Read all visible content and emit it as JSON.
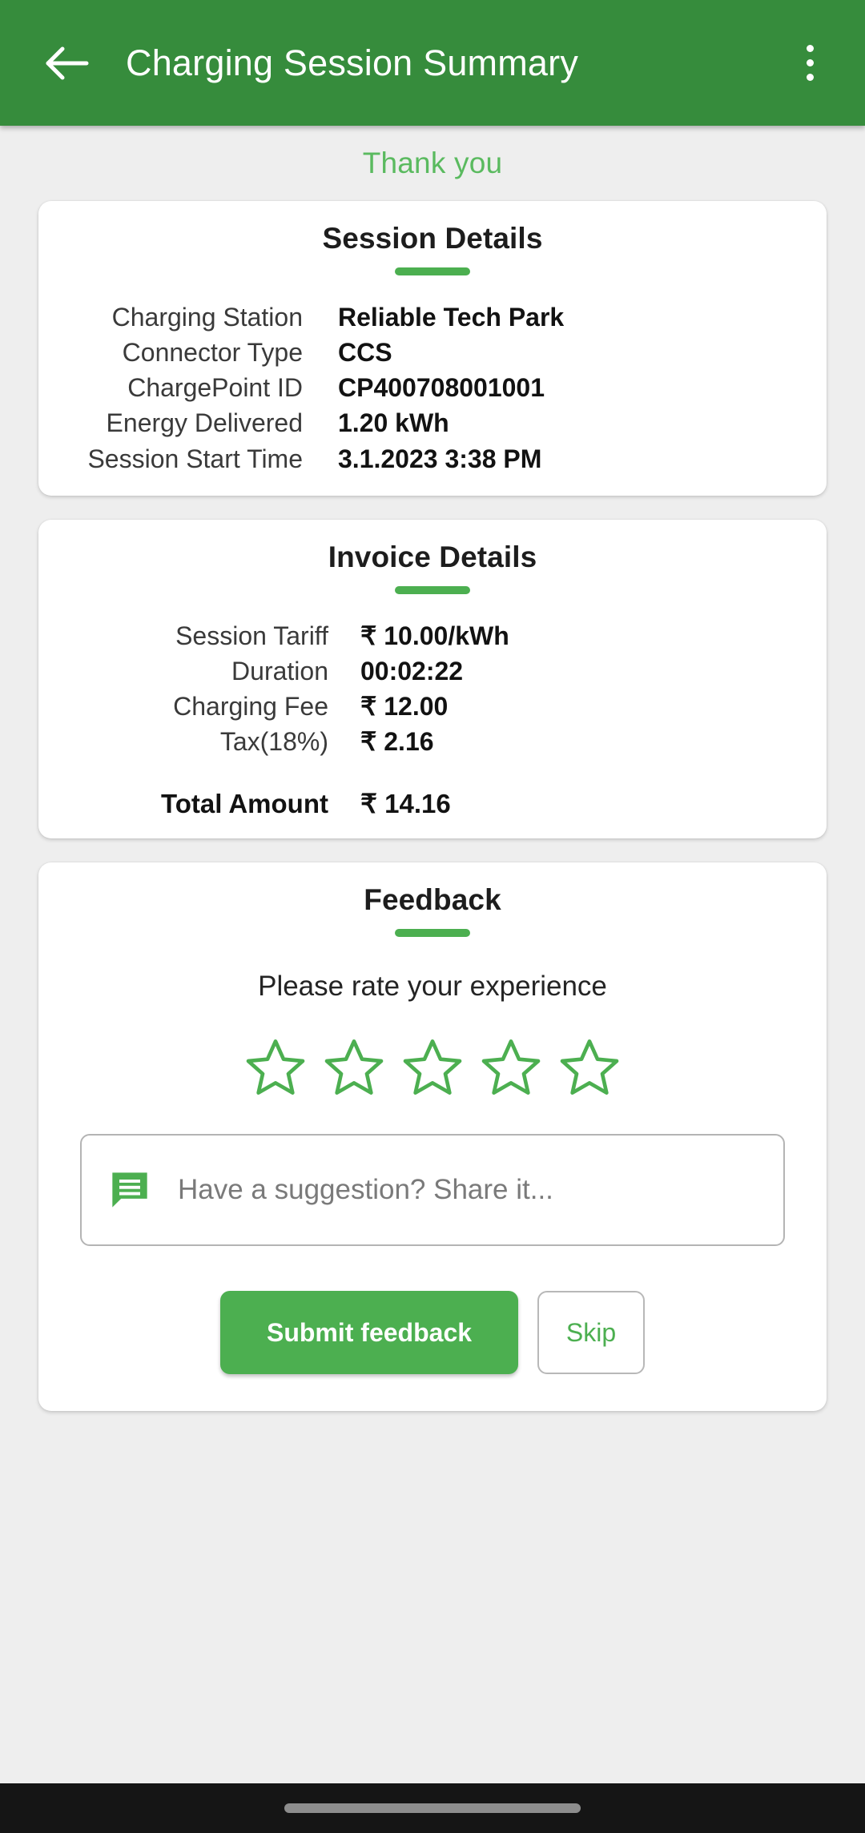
{
  "appbar": {
    "back_icon": "arrow-left-icon",
    "title": "Charging Session Summary",
    "overflow_icon": "more-vertical-icon"
  },
  "thank_you": "Thank you",
  "session_details": {
    "title": "Session Details",
    "rows": [
      {
        "label": "Charging Station",
        "value": "Reliable Tech Park"
      },
      {
        "label": "Connector Type",
        "value": "CCS"
      },
      {
        "label": "ChargePoint ID",
        "value": "CP400708001001"
      },
      {
        "label": "Energy Delivered",
        "value": "1.20 kWh"
      },
      {
        "label": "Session Start Time",
        "value": "3.1.2023 3:38 PM"
      }
    ]
  },
  "invoice_details": {
    "title": "Invoice Details",
    "rows": [
      {
        "label": "Session Tariff",
        "value": "₹ 10.00/kWh"
      },
      {
        "label": "Duration",
        "value": "00:02:22"
      },
      {
        "label": "Charging Fee",
        "value": "₹ 12.00"
      },
      {
        "label": "Tax(18%)",
        "value": "₹ 2.16"
      }
    ],
    "total_label": "Total Amount",
    "total_value": "₹ 14.16"
  },
  "feedback": {
    "title": "Feedback",
    "prompt": "Please rate your experience",
    "rating": 0,
    "stars_total": 5,
    "star_icon": "star-outline-icon",
    "suggestion_icon": "chat-bubble-icon",
    "suggestion_placeholder": "Have a suggestion? Share it...",
    "suggestion_value": "",
    "submit_label": "Submit feedback",
    "skip_label": "Skip"
  },
  "colors": {
    "appbar_green": "#368c3c",
    "accent_green": "#4caf50",
    "thank_you_green": "#5aba5f",
    "page_background": "#eeeeee",
    "card_background": "#ffffff",
    "navbar_background": "#151515"
  }
}
